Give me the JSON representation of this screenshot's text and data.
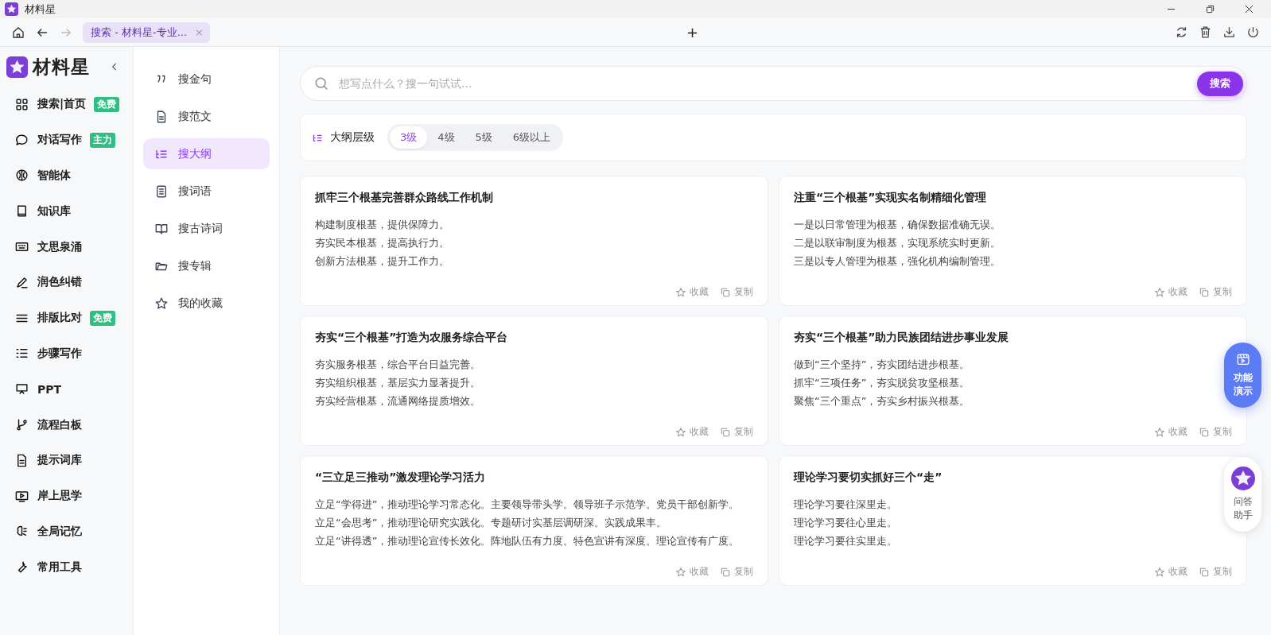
{
  "window": {
    "title": "材料星"
  },
  "browser_tabs": [
    {
      "label": "搜索 - 材料星-专业...",
      "close": "×",
      "selected": true
    }
  ],
  "new_tab": "+",
  "brand": {
    "name": "材料星"
  },
  "sidebar": {
    "items": [
      {
        "label": "搜索|首页",
        "badge": "免费"
      },
      {
        "label": "对话写作",
        "badge": "主力"
      },
      {
        "label": "智能体"
      },
      {
        "label": "知识库"
      },
      {
        "label": "文思泉涌"
      },
      {
        "label": "润色纠错"
      },
      {
        "label": "排版比对",
        "badge": "免费"
      },
      {
        "label": "步骤写作"
      },
      {
        "label": "PPT"
      },
      {
        "label": "流程白板"
      },
      {
        "label": "提示词库"
      },
      {
        "label": "岸上思学"
      },
      {
        "label": "全局记忆"
      },
      {
        "label": "常用工具"
      }
    ]
  },
  "search_menu": [
    {
      "label": "搜金句",
      "selected": false
    },
    {
      "label": "搜范文",
      "selected": false
    },
    {
      "label": "搜大纲",
      "selected": true
    },
    {
      "label": "搜词语",
      "selected": false
    },
    {
      "label": "搜古诗词",
      "selected": false
    },
    {
      "label": "搜专辑",
      "selected": false
    },
    {
      "label": "我的收藏",
      "selected": false
    }
  ],
  "search": {
    "placeholder": "想写点什么？搜一句试试...",
    "button": "搜索"
  },
  "outline_level": {
    "label": "大纲层级",
    "options": [
      {
        "label": "3级",
        "selected": true
      },
      {
        "label": "4级",
        "selected": false
      },
      {
        "label": "5级",
        "selected": false
      },
      {
        "label": "6级以上",
        "selected": false
      }
    ]
  },
  "cards": [
    {
      "title": "抓牢三个根基完善群众路线工作机制",
      "lines": [
        "构建制度根基，提供保障力。",
        "夯实民本根基，提高执行力。",
        "创新方法根基，提升工作力。"
      ],
      "favorite": "收藏",
      "copy": "复制"
    },
    {
      "title": "注重“三个根基”实现实名制精细化管理",
      "lines": [
        "一是以日常管理为根基，确保数据准确无误。",
        "二是以联审制度为根基，实现系统实时更新。",
        "三是以专人管理为根基，强化机构编制管理。"
      ],
      "favorite": "收藏",
      "copy": "复制"
    },
    {
      "title": "夯实“三个根基”打造为农服务综合平台",
      "lines": [
        "夯实服务根基，综合平台日益完善。",
        "夯实组织根基，基层实力显著提升。",
        "夯实经营根基，流通网络提质增效。"
      ],
      "favorite": "收藏",
      "copy": "复制"
    },
    {
      "title": "夯实“三个根基”助力民族团结进步事业发展",
      "lines": [
        "做到“三个坚持”，夯实团结进步根基。",
        "抓牢“三项任务”，夯实脱贫攻坚根基。",
        "聚焦“三个重点”，夯实乡村振兴根基。"
      ],
      "favorite": "收藏",
      "copy": "复制"
    },
    {
      "title": "“三立足三推动”激发理论学习活力",
      "lines": [
        "立足“学得进”，推动理论学习常态化。主要领导带头学。领导班子示范学。党员干部创新学。",
        "立足“会思考”，推动理论研究实践化。专题研讨实基层调研深。实践成果丰。",
        "立足“讲得透”，推动理论宣传长效化。阵地队伍有力度。特色宣讲有深度。理论宣传有广度。"
      ],
      "favorite": "收藏",
      "copy": "复制"
    },
    {
      "title": "理论学习要切实抓好三个“走”",
      "lines": [
        "理论学习要往深里走。",
        "理论学习要往心里走。",
        "理论学习要往实里走。"
      ],
      "favorite": "收藏",
      "copy": "复制"
    }
  ],
  "float_buttons": [
    {
      "kind": "demo",
      "label": "功能演示"
    },
    {
      "kind": "assistant",
      "label": "问答助手"
    }
  ]
}
